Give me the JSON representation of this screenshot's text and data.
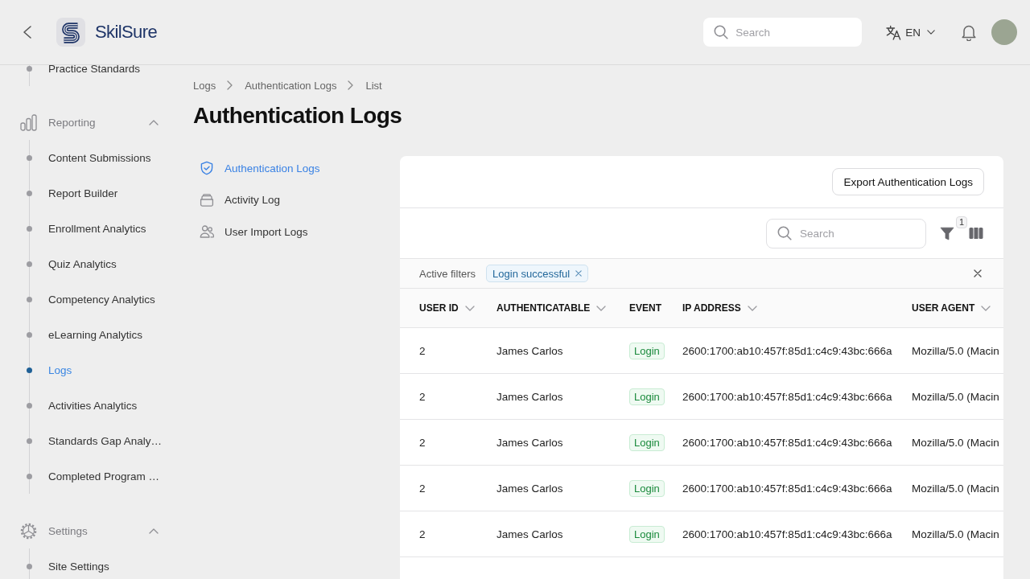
{
  "header": {
    "brand": "SkilSure",
    "search": {
      "placeholder": "Search"
    },
    "language": "EN"
  },
  "sidebar": {
    "groups": [
      {
        "items": [
          {
            "label": "Practice Standards",
            "selected": false
          }
        ]
      },
      {
        "label": "Reporting",
        "expanded": true,
        "items": [
          {
            "label": "Content Submissions",
            "selected": false
          },
          {
            "label": "Report Builder",
            "selected": false
          },
          {
            "label": "Enrollment Analytics",
            "selected": false
          },
          {
            "label": "Quiz Analytics",
            "selected": false
          },
          {
            "label": "Competency Analytics",
            "selected": false
          },
          {
            "label": "eLearning Analytics",
            "selected": false
          },
          {
            "label": "Logs",
            "selected": true
          },
          {
            "label": "Activities Analytics",
            "selected": false
          },
          {
            "label": "Standards Gap Analy…",
            "selected": false
          },
          {
            "label": "Completed Program …",
            "selected": false
          }
        ]
      },
      {
        "label": "Settings",
        "expanded": true,
        "items": [
          {
            "label": "Site Settings",
            "selected": false
          }
        ]
      }
    ]
  },
  "breadcrumb": [
    "Logs",
    "Authentication Logs",
    "List"
  ],
  "page_title": "Authentication Logs",
  "subnav": [
    {
      "label": "Authentication Logs",
      "selected": true
    },
    {
      "label": "Activity Log",
      "selected": false
    },
    {
      "label": "User Import Logs",
      "selected": false
    }
  ],
  "card": {
    "export_button": "Export Authentication Logs",
    "search": {
      "placeholder": "Search"
    },
    "filter_count": "1",
    "active_filters": {
      "label": "Active filters",
      "chips": [
        {
          "label": "Login successful"
        }
      ]
    },
    "table": {
      "columns": [
        {
          "label": "USER ID",
          "sortable": true
        },
        {
          "label": "AUTHENTICATABLE",
          "sortable": true
        },
        {
          "label": "EVENT",
          "sortable": false
        },
        {
          "label": "IP ADDRESS",
          "sortable": true
        },
        {
          "label": "USER AGENT",
          "sortable": true
        }
      ],
      "rows": [
        {
          "user_id": "2",
          "authenticatable": "James Carlos",
          "event": "Login",
          "ip_address": "2600:1700:ab10:457f:85d1:c4c9:43bc:666a",
          "user_agent": "Mozilla/5.0 (Macin"
        },
        {
          "user_id": "2",
          "authenticatable": "James Carlos",
          "event": "Login",
          "ip_address": "2600:1700:ab10:457f:85d1:c4c9:43bc:666a",
          "user_agent": "Mozilla/5.0 (Macin"
        },
        {
          "user_id": "2",
          "authenticatable": "James Carlos",
          "event": "Login",
          "ip_address": "2600:1700:ab10:457f:85d1:c4c9:43bc:666a",
          "user_agent": "Mozilla/5.0 (Macin"
        },
        {
          "user_id": "2",
          "authenticatable": "James Carlos",
          "event": "Login",
          "ip_address": "2600:1700:ab10:457f:85d1:c4c9:43bc:666a",
          "user_agent": "Mozilla/5.0 (Macin"
        },
        {
          "user_id": "2",
          "authenticatable": "James Carlos",
          "event": "Login",
          "ip_address": "2600:1700:ab10:457f:85d1:c4c9:43bc:666a",
          "user_agent": "Mozilla/5.0 (Macin"
        }
      ]
    }
  }
}
